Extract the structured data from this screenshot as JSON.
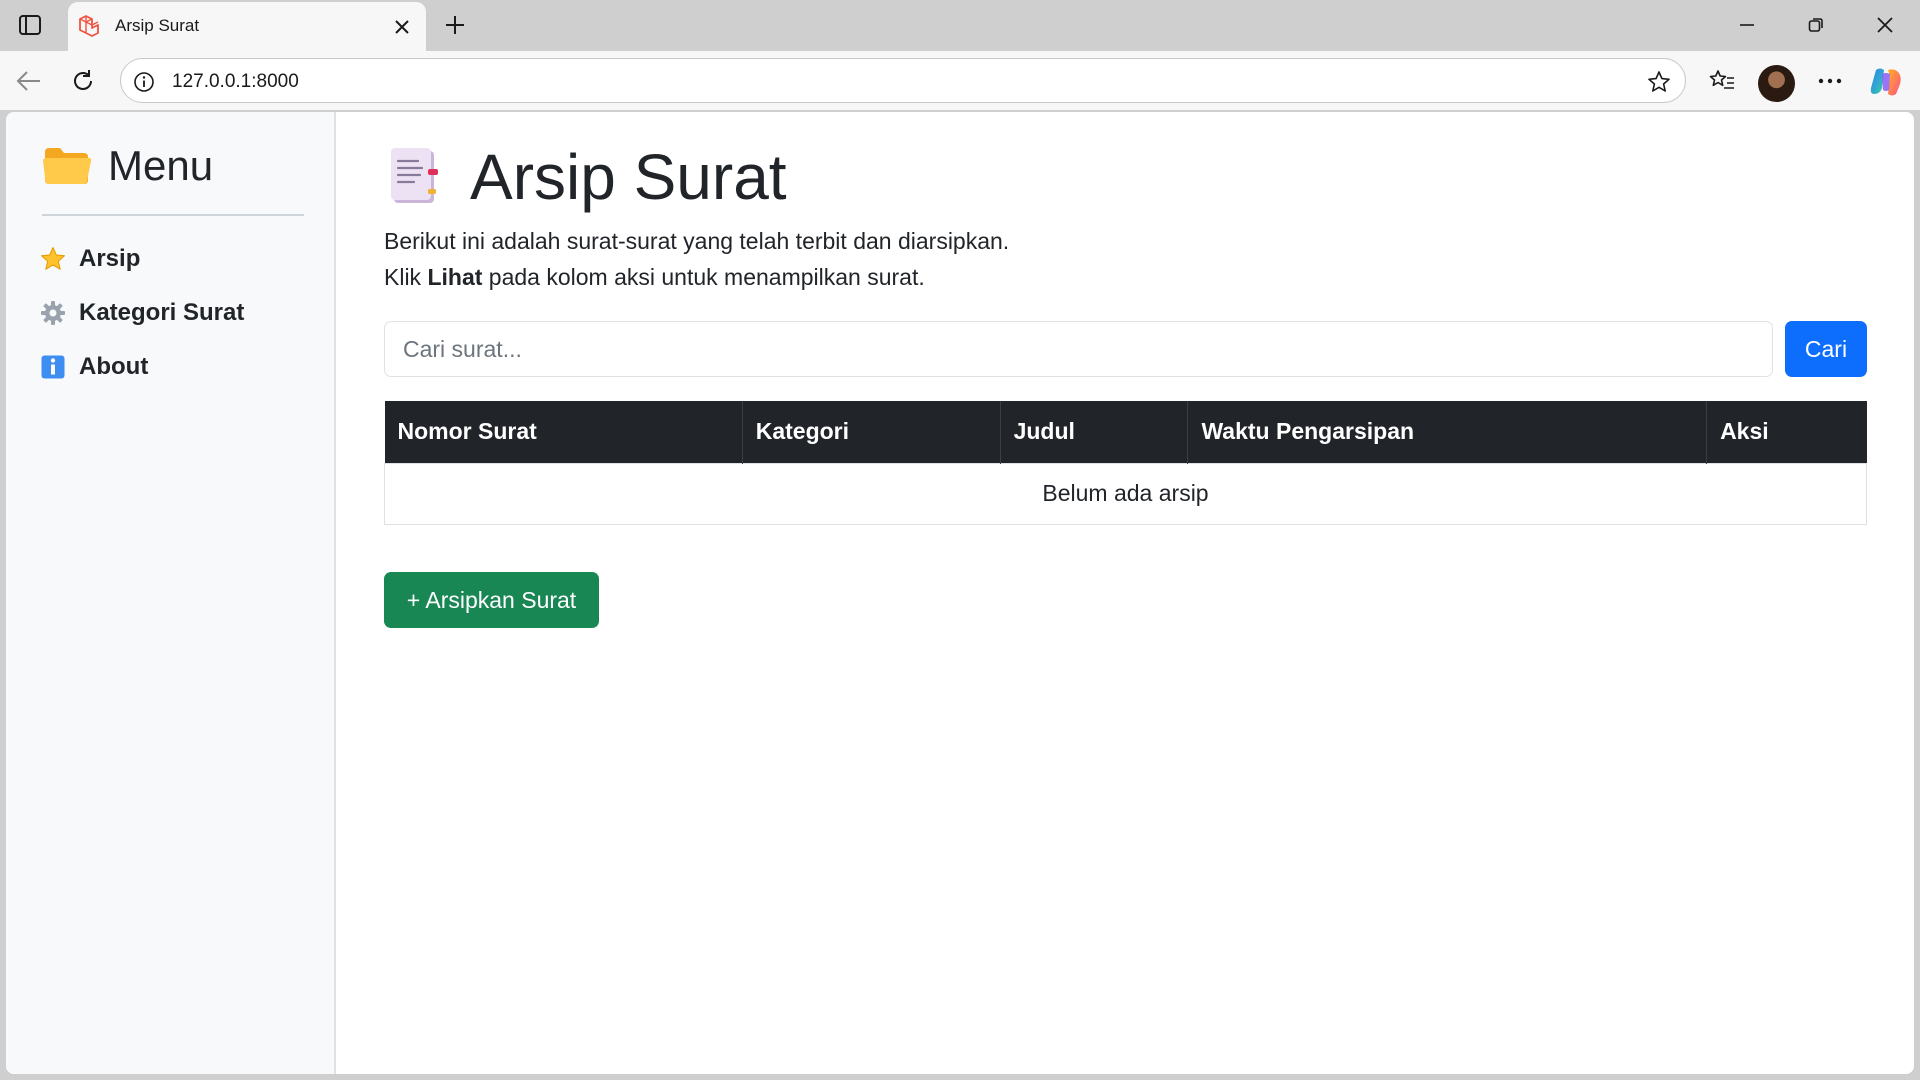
{
  "browser": {
    "tab_title": "Arsip Surat",
    "url": "127.0.0.1:8000"
  },
  "sidebar": {
    "heading": "Menu",
    "items": [
      {
        "label": "Arsip",
        "icon": "star-icon"
      },
      {
        "label": "Kategori Surat",
        "icon": "gear-icon"
      },
      {
        "label": "About",
        "icon": "info-icon"
      }
    ]
  },
  "main": {
    "title": "Arsip Surat",
    "desc_line1": "Berikut ini adalah surat-surat yang telah terbit dan diarsipkan.",
    "desc_line2_pre": "Klik ",
    "desc_line2_bold": "Lihat",
    "desc_line2_post": " pada kolom aksi untuk menampilkan surat.",
    "search": {
      "placeholder": "Cari surat...",
      "value": "",
      "button_label": "Cari"
    },
    "table": {
      "columns": [
        "Nomor Surat",
        "Kategori",
        "Judul",
        "Waktu Pengarsipan",
        "Aksi"
      ],
      "empty_message": "Belum ada arsip"
    },
    "add_button_label": "+ Arsipkan Surat"
  },
  "colors": {
    "primary": "#0d6efd",
    "success": "#198754",
    "table_header": "#212529",
    "sidebar_bg": "#f8f9fa"
  }
}
